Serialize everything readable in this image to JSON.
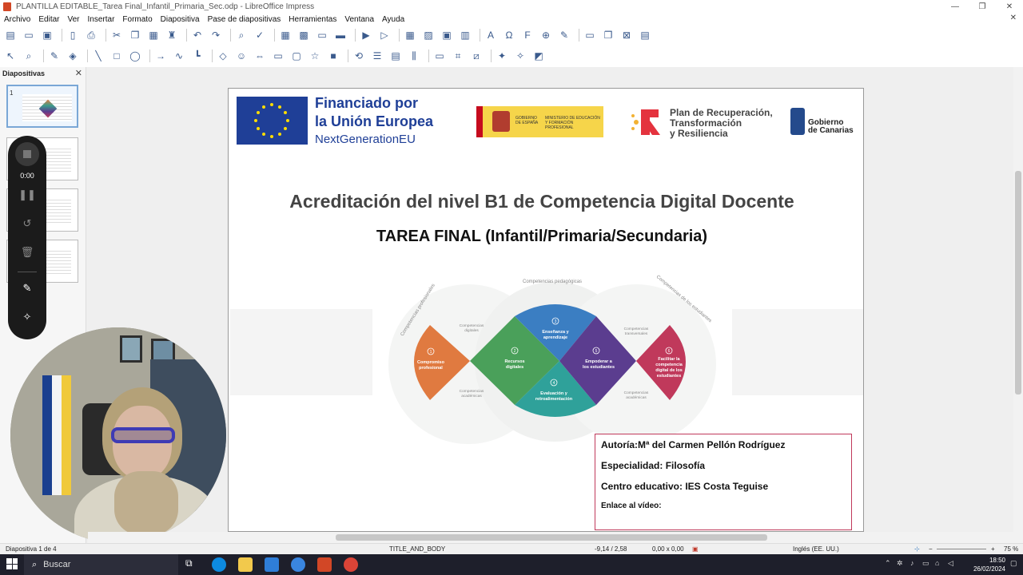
{
  "window": {
    "title": "PLANTILLA EDITABLE_Tarea Final_Infantil_Primaria_Sec.odp - LibreOffice Impress",
    "minimize": "—",
    "restore": "❐",
    "close": "✕"
  },
  "menu": [
    "Archivo",
    "Editar",
    "Ver",
    "Insertar",
    "Formato",
    "Diapositiva",
    "Pase de diapositivas",
    "Herramientas",
    "Ventana",
    "Ayuda"
  ],
  "menu_close": "✕",
  "panel": {
    "title": "Diapositivas",
    "close": "✕",
    "slide1_number": "1"
  },
  "recorder": {
    "time": "0:00",
    "pause_icon": "pause-icon",
    "restart_icon": "restart-icon",
    "delete_icon": "trash-icon",
    "pen_icon": "pen-icon",
    "effects_icon": "effects-icon"
  },
  "slide": {
    "eu_line1": "Financiado por",
    "eu_line2": "la Unión Europea",
    "eu_line3": "NextGenerationEU",
    "gob_esp_left": "GOBIERNO DE ESPAÑA",
    "gob_esp_right": "MINISTERIO DE EDUCACIÓN Y FORMACIÓN PROFESIONAL",
    "prtr_line1": "Plan de Recuperación,",
    "prtr_line2": "Transformación",
    "prtr_line3": "y Resiliencia",
    "canarias_line1": "Gobierno",
    "canarias_line2": "de Canarias",
    "main_title": "Acreditación del nivel B1 de Competencia Digital Docente",
    "sub_title": "TAREA FINAL (Infantil/Primaria/Secundaria)",
    "diagram": {
      "arc_left": "Competencias profesionales",
      "arc_top": "Competencias pedagógicas",
      "arc_right": "Competencias de los estudiantes",
      "areas": [
        {
          "num": "1",
          "line1": "Compromiso",
          "line2": "profesional",
          "line3": "",
          "line4": "",
          "color": "#e07a40"
        },
        {
          "num": "2",
          "line1": "Recursos",
          "line2": "digitales",
          "line3": "",
          "line4": "",
          "color": "#4aa05a"
        },
        {
          "num": "3",
          "line1": "Enseñanza y",
          "line2": "aprendizaje",
          "line3": "",
          "line4": "",
          "color": "#3b7ec2"
        },
        {
          "num": "4",
          "line1": "Evaluación y",
          "line2": "retroalimentación",
          "line3": "",
          "line4": "",
          "color": "#2fa19a"
        },
        {
          "num": "5",
          "line1": "Empoderar a",
          "line2": "los estudiantes",
          "line3": "",
          "line4": "",
          "color": "#5b3d8f"
        },
        {
          "num": "6",
          "line1": "Facilitar la",
          "line2": "competencia",
          "line3": "digital de los",
          "line4": "estudiantes",
          "color": "#c0395b"
        }
      ],
      "small_labels": {
        "digitales_l1": "Competencias",
        "digitales_l2": "digitales",
        "transv_l1": "Competencias",
        "transv_l2": "transversales",
        "acad_left_l1": "Competencias",
        "acad_left_l2": "académicas",
        "acad_right_l1": "Competencias",
        "acad_right_l2": "académicas"
      }
    },
    "info": {
      "autoria": "Autoría:Mª del Carmen Pellón Rodríguez",
      "especialidad": "Especialidad: Filosofía",
      "centro": "Centro educativo: IES Costa Teguise",
      "enlace": "Enlace al vídeo:"
    }
  },
  "status": {
    "slide_info": "Diapositiva 1 de 4",
    "layout": "TITLE_AND_BODY",
    "position": "-9,14 / 2,58",
    "size": "0,00 x 0,00",
    "language": "Inglés (EE. UU.)",
    "zoom": "75 %",
    "zoom_minus": "−",
    "zoom_plus": "+"
  },
  "taskbar": {
    "search": "Buscar",
    "time": "18:50",
    "date": "26/02/2024"
  },
  "colors": {
    "eu_blue": "#1f3f97",
    "accent_red": "#c0395b"
  }
}
